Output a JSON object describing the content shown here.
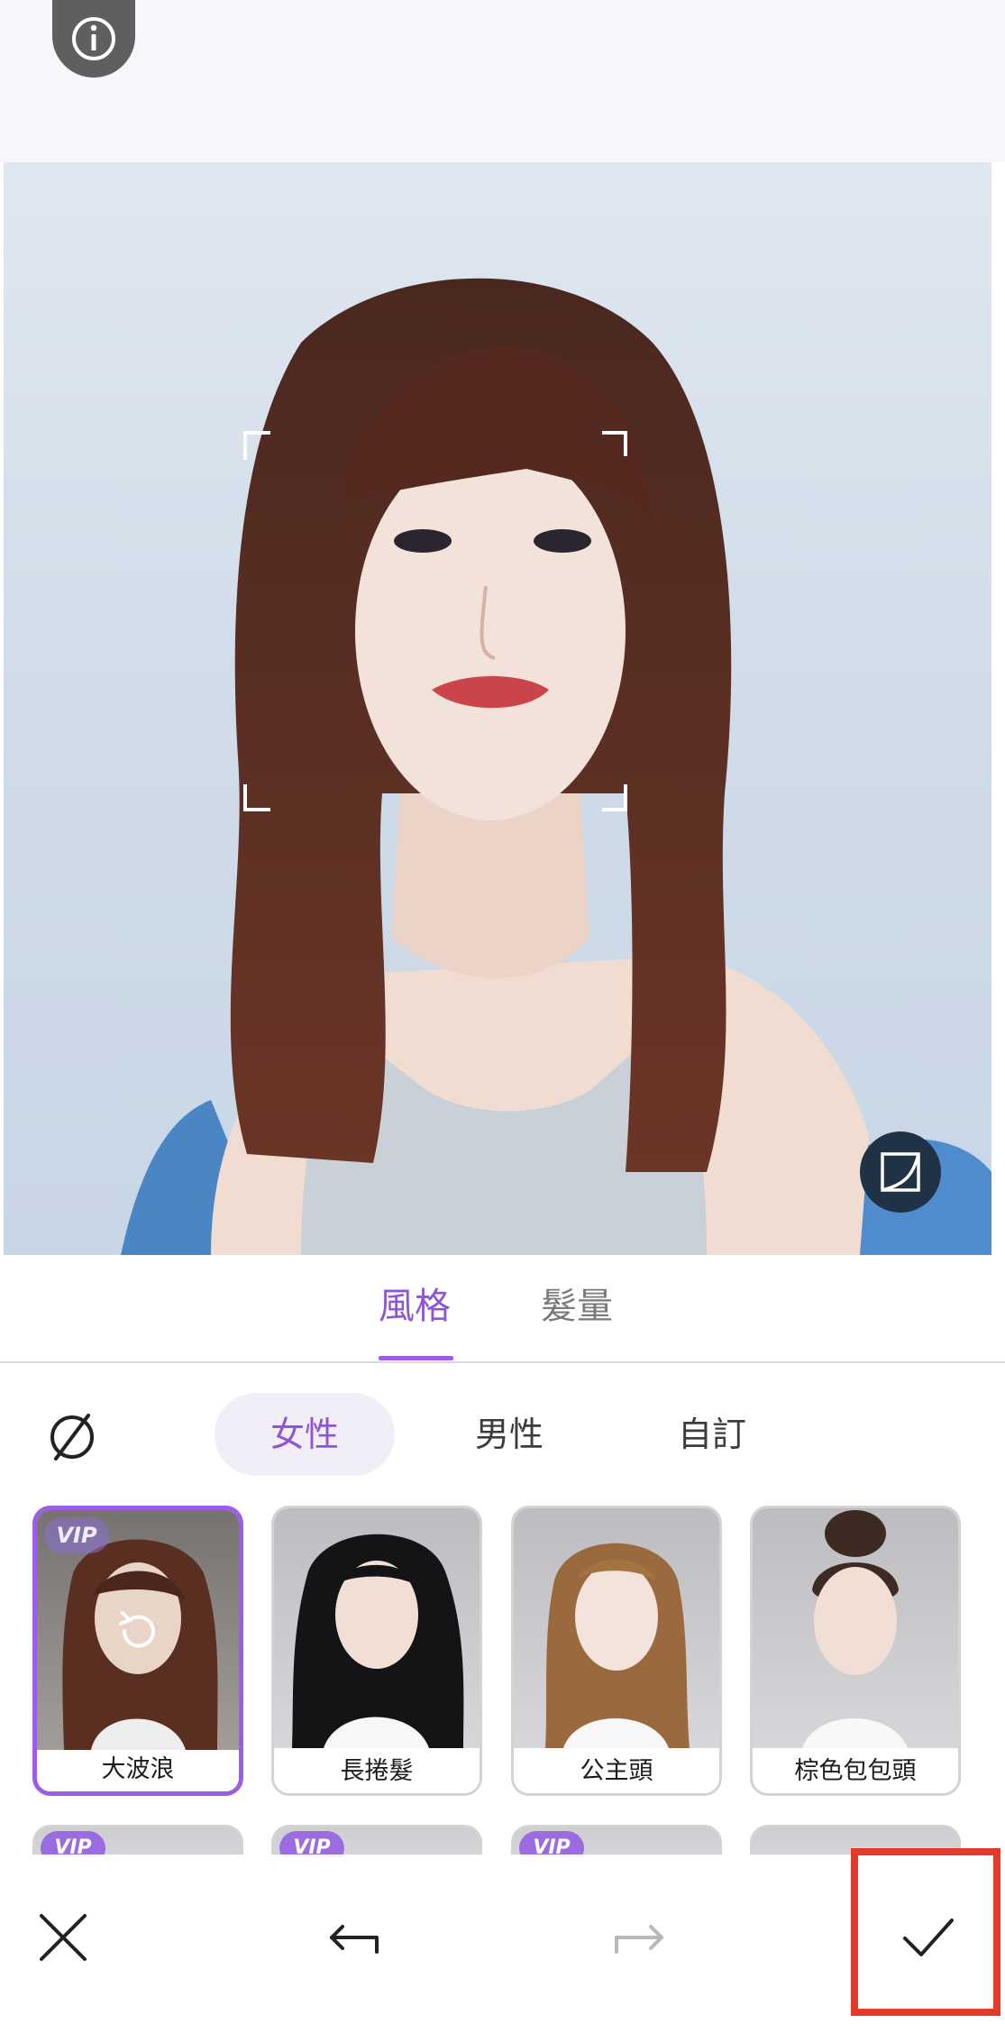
{
  "toolbar": {
    "info_icon": "info-icon"
  },
  "photo": {
    "compare_icon": "compare-icon"
  },
  "tabs": [
    {
      "label": "風格",
      "active": true
    },
    {
      "label": "髮量",
      "active": false
    }
  ],
  "gender": {
    "none_icon": "no-style-icon",
    "options": [
      {
        "label": "女性",
        "active": true
      },
      {
        "label": "男性",
        "active": false
      },
      {
        "label": "自訂",
        "active": false
      }
    ]
  },
  "styles": [
    {
      "label": "大波浪",
      "vip": "VIP",
      "selected": true,
      "hair": "#5a2f22"
    },
    {
      "label": "長捲髮",
      "vip": "",
      "selected": false,
      "hair": "#141416"
    },
    {
      "label": "公主頭",
      "vip": "",
      "selected": false,
      "hair": "#9a6a3e"
    },
    {
      "label": "棕色包包頭",
      "vip": "",
      "selected": false,
      "hair": "#3d2a22"
    }
  ],
  "styles_row2": [
    {
      "vip": "VIP"
    },
    {
      "vip": "VIP"
    },
    {
      "vip": "VIP"
    },
    {
      "vip": ""
    }
  ],
  "actions": {
    "close_icon": "close-icon",
    "undo_icon": "undo-icon",
    "redo_icon": "redo-icon",
    "confirm_icon": "checkmark-icon"
  },
  "colors": {
    "accent": "#9b5de5",
    "highlight_box": "#e23b2b"
  }
}
